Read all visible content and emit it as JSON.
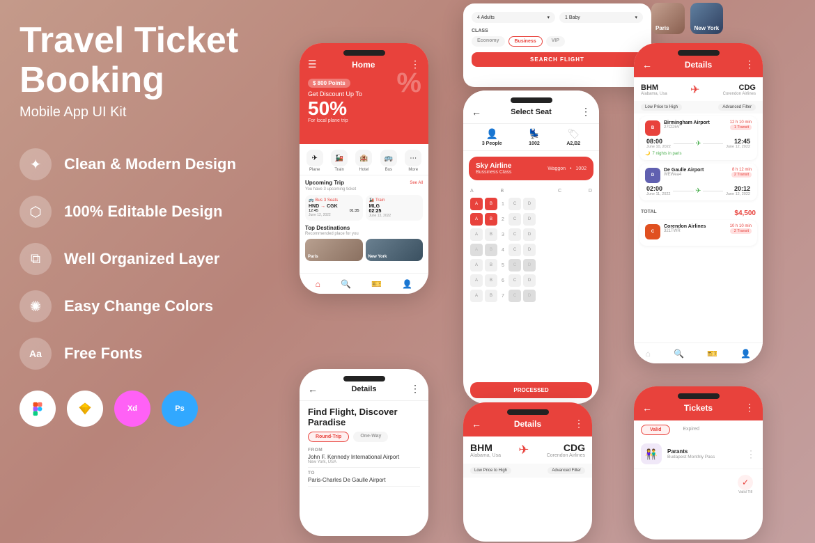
{
  "app": {
    "title_line1": "Travel Ticket",
    "title_line2": "Booking",
    "subtitle": "Mobile App UI Kit"
  },
  "features": [
    {
      "id": "clean",
      "icon": "✦",
      "text": "Clean & Modern Design"
    },
    {
      "id": "editable",
      "icon": "⬡",
      "text": "100% Editable Design"
    },
    {
      "id": "layer",
      "icon": "⧉",
      "text": "Well Organized Layer"
    },
    {
      "id": "colors",
      "icon": "✺",
      "text": "Easy Change Colors"
    },
    {
      "id": "fonts",
      "icon": "Aa",
      "text": "Free Fonts"
    }
  ],
  "tools": [
    {
      "id": "figma",
      "icon": "F",
      "label": "Figma"
    },
    {
      "id": "sketch",
      "icon": "S",
      "label": "Sketch"
    },
    {
      "id": "xd",
      "icon": "Xd",
      "label": "XD"
    },
    {
      "id": "ps",
      "icon": "Ps",
      "label": "Photoshop"
    }
  ],
  "phone1": {
    "screen_title": "Home",
    "points_badge": "$ 800 Points",
    "discount_text": "Get Discount Up To",
    "big_percent": "50%",
    "local_text": "For local plane trip",
    "categories": [
      "Plane",
      "Train",
      "Hotel",
      "Bus",
      "More"
    ],
    "upcoming_title": "Upcoming Trip",
    "upcoming_sub": "You have 3 upcoming ticket",
    "see_all": "See All",
    "ticket1_type": "Bus",
    "ticket1_seats": "3 Seats",
    "ticket1_from": "HND",
    "ticket1_to": "CGK",
    "ticket1_depart": "12:45",
    "ticket1_arrive": "01:35",
    "ticket1_date1": "June 12, 2022",
    "ticket1_date2": "June 12, 2022",
    "ticket2_type": "Train",
    "ticket2_code": "MLG",
    "ticket2_time": "02:25",
    "ticket2_date": "June 13, 2022",
    "top_dest_title": "Top Destinations",
    "top_dest_sub": "Recommended place for you",
    "dest1": "Paris",
    "dest2": "New York"
  },
  "phone2": {
    "title": "Select Seat",
    "passengers": "3 People",
    "seat_code": "1002",
    "seat_ref": "A2,B2",
    "airline": "Sky Airline",
    "class": "Bussiness Class",
    "waggon": "Waggon",
    "waggon_number": "1002",
    "process_btn": "PROCESSED"
  },
  "phone3": {
    "title": "Details",
    "from_code": "BHM",
    "from_label": "Alabama, Usa",
    "to_code": "CDG",
    "to_label": "Corendon Airlines",
    "filter1": "Low Price to High",
    "filter2": "Advanced Filter",
    "flights": [
      {
        "airport": "Birmingham Airport",
        "code": "27CD5V",
        "depart": "08:00",
        "arrive": "12:45",
        "depart_date": "June 10, 2022",
        "arrive_date": "June 12, 2022",
        "duration": "12 h 10 min",
        "transit": "1 Transit",
        "highlight": "7 nights in paris"
      },
      {
        "airport": "De Gaulle Airport",
        "code": "WEWea4",
        "depart": "02:00",
        "arrive": "20:12",
        "depart_date": "June 11, 2022",
        "arrive_date": "June 12, 2022",
        "duration": "8 h 12 min",
        "transit": "2 Transit"
      }
    ],
    "total_label": "TOTAL",
    "total_price": "$4,500",
    "airline3": "Corendon Airlines",
    "airline3_code": "321TWR",
    "airline3_duration": "10 h 10 min",
    "airline3_transit": "2 Transit"
  },
  "phone4": {
    "title": "Details",
    "discover": "Find Flight, Discover\nParadise",
    "trip_type1": "Round-Trip",
    "trip_type2": "One-Way",
    "from_label": "FROM",
    "from_value": "John F. Kennedy International Airport",
    "from_sub": "New York, USA",
    "to_label": "TO",
    "to_value": "Paris-Charles De Gaulle Airport"
  },
  "phone5": {
    "adults": "4 Adults",
    "baby": "1 Baby",
    "class_label": "CLASS",
    "class_economy": "Economy",
    "class_business": "Business",
    "class_vip": "VIP",
    "search_btn": "SEARCH FLIGHT"
  },
  "phone6": {
    "title": "Details",
    "from_code": "BHM",
    "from_label": "Alabama, Usa",
    "to_code": "CDG",
    "to_label": "Corendon Airlines",
    "filter1": "Low Price to High",
    "filter2": "Advanced Filter"
  },
  "phone7": {
    "title": "Tickets",
    "tab_valid": "Valid",
    "tab_expired": "Expired",
    "ticket_name": "Parants",
    "ticket_pass": "Budapest Monthly Pass",
    "valid_label": "Valid Till"
  },
  "colors": {
    "primary": "#e8423c",
    "white": "#ffffff",
    "bg": "#c49a8a"
  }
}
